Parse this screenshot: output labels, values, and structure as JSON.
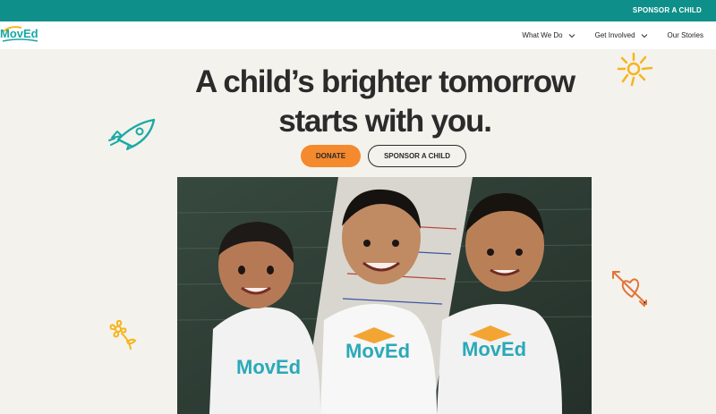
{
  "topbar": {
    "sponsor_link": "SPONSOR A CHILD"
  },
  "nav": {
    "logo_text": "MovEd",
    "items": [
      {
        "label": "What We Do",
        "has_dropdown": true
      },
      {
        "label": "Get Involved",
        "has_dropdown": true
      },
      {
        "label": "Our Stories",
        "has_dropdown": false
      }
    ]
  },
  "hero": {
    "title_line1": "A child’s brighter tomorrow",
    "title_line2": "starts with you.",
    "donate_label": "DONATE",
    "sponsor_label": "SPONSOR A CHILD"
  },
  "photo": {
    "shirt_text": "MovEd"
  },
  "colors": {
    "teal": "#0f8f8a",
    "orange": "#f5892d",
    "background": "#f4f2ec",
    "yellow": "#f5b51e",
    "rocket": "#1aa9a6",
    "heart": "#e2743a"
  }
}
